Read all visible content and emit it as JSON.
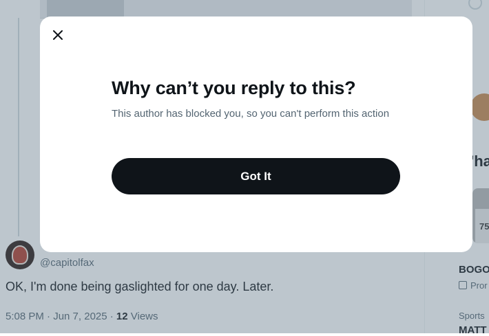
{
  "modal": {
    "close_icon": "close-icon",
    "title": "Why can’t you reply to this?",
    "body": "This author has blocked you, so you can't perform this action",
    "button_label": "Got It"
  },
  "tweet": {
    "handle": "@capitolfax",
    "text": "OK, I'm done being gaslighted for one day.  Later.",
    "time": "5:08 PM · Jun 7, 2025 · ",
    "views_count": "12",
    "views_label": " Views"
  },
  "sidebar": {
    "heading": "'ha",
    "jersey_number": "75",
    "item_title": "BOGO",
    "promo_label": "Pror",
    "category": "Sports",
    "item_title_2": "MATT"
  },
  "colors": {
    "text_primary": "#0f1419",
    "text_secondary": "#536471",
    "button_bg": "#0f1419",
    "overlay": "rgba(91,112,131,0.40)"
  }
}
